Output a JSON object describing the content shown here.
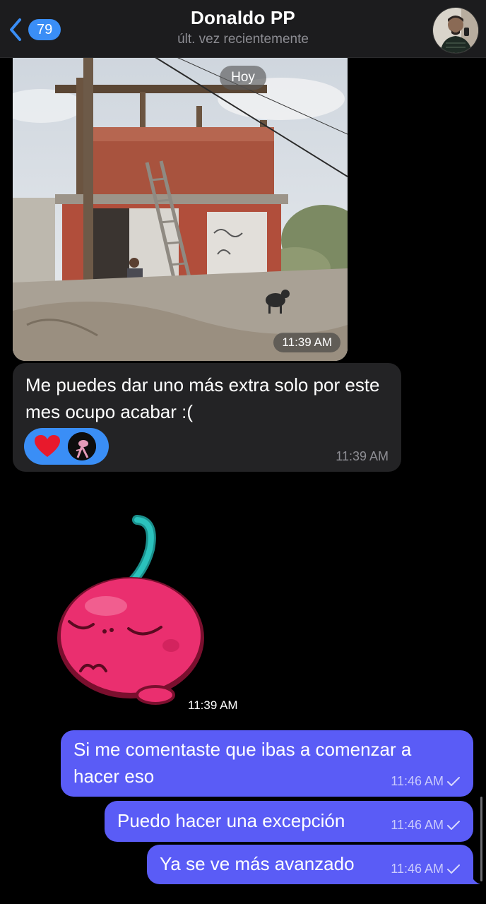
{
  "header": {
    "back_count": "79",
    "contact_name": "Donaldo PP",
    "status": "últ. vez recientemente"
  },
  "date_separator": "Hoy",
  "messages": {
    "photo": {
      "time": "11:39 AM"
    },
    "incoming_text": {
      "text": "Me puedes dar uno más extra solo por este mes ocupo acabar :(",
      "time": "11:39 AM",
      "reactions": [
        "heart"
      ]
    },
    "sticker": {
      "time": "11:39 AM"
    },
    "outgoing": [
      {
        "text": "Si me comentaste que ibas a comenzar a hacer eso",
        "time": "11:46 AM"
      },
      {
        "text": "Puedo hacer una excepción",
        "time": "11:46 AM"
      },
      {
        "text": "Ya se ve más avanzado",
        "time": "11:46 AM"
      }
    ]
  },
  "colors": {
    "accent_blue": "#3a8ef6",
    "outgoing_bubble": "#5a5cf6",
    "incoming_bubble": "#232325",
    "background": "#000000"
  }
}
